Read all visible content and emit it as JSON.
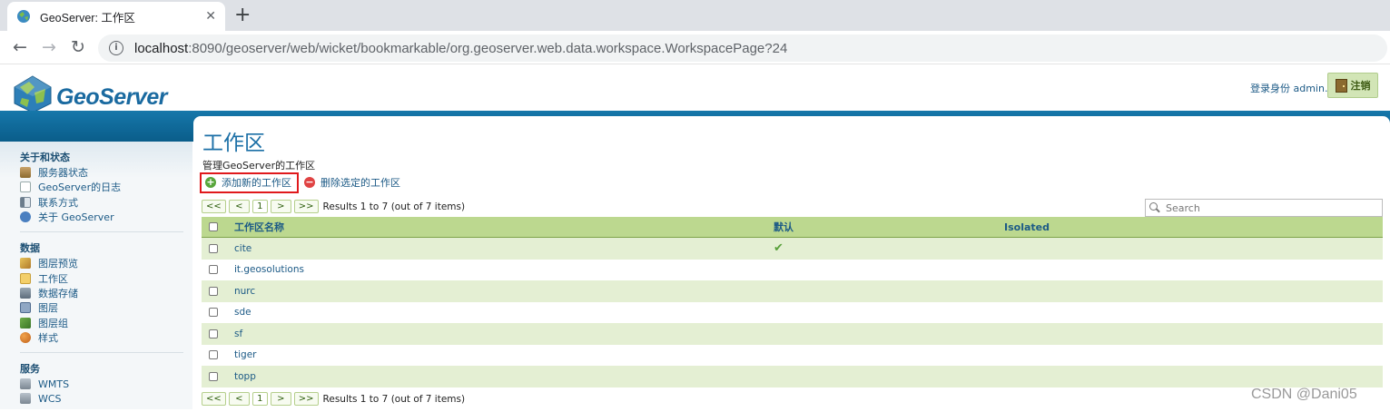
{
  "browser": {
    "tab_title": "GeoServer: 工作区",
    "tab_close": "✕",
    "new_tab": "+",
    "url_host": "localhost",
    "url_path": ":8090/geoserver/web/wicket/bookmarkable/org.geoserver.web.data.workspace.WorkspacePage?24"
  },
  "header": {
    "logo_text": "GeoServer",
    "login_label": "登录身份 admin.",
    "logout_label": "注销"
  },
  "sidebar": {
    "sections": [
      {
        "title": "关于和状态",
        "items": [
          {
            "label": "服务器状态",
            "icon": "server-status-icon"
          },
          {
            "label": "GeoServer的日志",
            "icon": "log-page-icon"
          },
          {
            "label": "联系方式",
            "icon": "contact-card-icon"
          },
          {
            "label": "关于 GeoServer",
            "icon": "about-info-icon"
          }
        ]
      },
      {
        "title": "数据",
        "items": [
          {
            "label": "图层预览",
            "icon": "layer-preview-icon"
          },
          {
            "label": "工作区",
            "icon": "folder-icon"
          },
          {
            "label": "数据存储",
            "icon": "datastore-icon"
          },
          {
            "label": "图层",
            "icon": "layer-icon"
          },
          {
            "label": "图层组",
            "icon": "layer-group-icon"
          },
          {
            "label": "样式",
            "icon": "style-palette-icon"
          }
        ]
      },
      {
        "title": "服务",
        "items": [
          {
            "label": "WMTS",
            "icon": "service-icon"
          },
          {
            "label": "WCS",
            "icon": "service-icon"
          }
        ]
      }
    ]
  },
  "main": {
    "title": "工作区",
    "description": "管理GeoServer的工作区",
    "add_label": "添加新的工作区",
    "remove_label": "删除选定的工作区",
    "pager": {
      "first": "<<",
      "prev": "<",
      "page": "1",
      "next": ">",
      "last": ">>",
      "summary": "Results 1 to 7 (out of 7 items)"
    },
    "search_placeholder": "Search",
    "columns": {
      "name": "工作区名称",
      "default": "默认",
      "isolated": "Isolated"
    },
    "rows": [
      {
        "name": "cite",
        "default": "✔",
        "isolated": ""
      },
      {
        "name": "it.geosolutions",
        "default": "",
        "isolated": ""
      },
      {
        "name": "nurc",
        "default": "",
        "isolated": ""
      },
      {
        "name": "sde",
        "default": "",
        "isolated": ""
      },
      {
        "name": "sf",
        "default": "",
        "isolated": ""
      },
      {
        "name": "tiger",
        "default": "",
        "isolated": ""
      },
      {
        "name": "topp",
        "default": "",
        "isolated": ""
      }
    ]
  },
  "watermark": "CSDN @Dani05",
  "colors": {
    "brand_blue": "#0d6a9c",
    "link_blue": "#1c5a86",
    "row_green": "#e4efd3",
    "header_green": "#bcd88f",
    "highlight_red": "#e0191c"
  }
}
